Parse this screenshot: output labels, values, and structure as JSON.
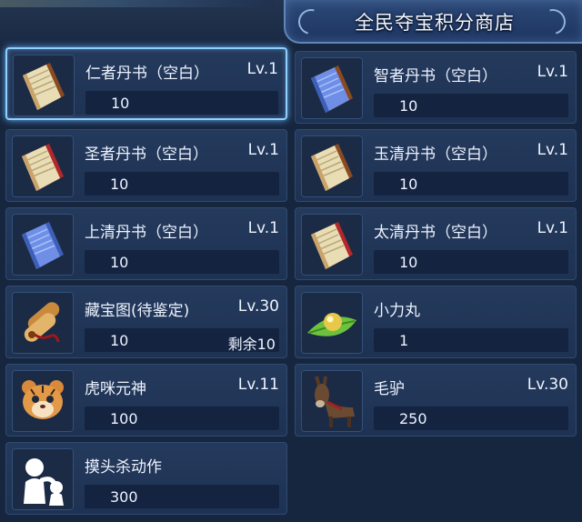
{
  "title": "全民夺宝积分商店",
  "items": [
    {
      "name": "仁者丹书（空白）",
      "level": "Lv.1",
      "qty": "10",
      "remain": "",
      "icon": "book-red-scroll-icon"
    },
    {
      "name": "智者丹书（空白）",
      "level": "Lv.1",
      "qty": "10",
      "remain": "",
      "icon": "book-blue-scroll-icon"
    },
    {
      "name": "圣者丹书（空白）",
      "level": "Lv.1",
      "qty": "10",
      "remain": "",
      "icon": "book-red-scroll-icon"
    },
    {
      "name": "玉清丹书（空白）",
      "level": "Lv.1",
      "qty": "10",
      "remain": "",
      "icon": "book-red-scroll-icon"
    },
    {
      "name": "上清丹书（空白）",
      "level": "Lv.1",
      "qty": "10",
      "remain": "",
      "icon": "book-blue-scroll-icon"
    },
    {
      "name": "太清丹书（空白）",
      "level": "Lv.1",
      "qty": "10",
      "remain": "",
      "icon": "book-red-scroll-icon"
    },
    {
      "name": "藏宝图(待鉴定)",
      "level": "Lv.30",
      "qty": "10",
      "remain": "剩余10",
      "icon": "treasure-map-icon"
    },
    {
      "name": "小力丸",
      "level": "",
      "qty": "1",
      "remain": "",
      "icon": "pill-on-leaf-icon"
    },
    {
      "name": "虎咪元神",
      "level": "Lv.11",
      "qty": "100",
      "remain": "",
      "icon": "tiger-cub-icon"
    },
    {
      "name": "毛驴",
      "level": "Lv.30",
      "qty": "250",
      "remain": "",
      "icon": "donkey-icon"
    },
    {
      "name": "摸头杀动作",
      "level": "",
      "qty": "300",
      "remain": "",
      "icon": "head-pat-emote-icon"
    }
  ],
  "selected_index": 0
}
